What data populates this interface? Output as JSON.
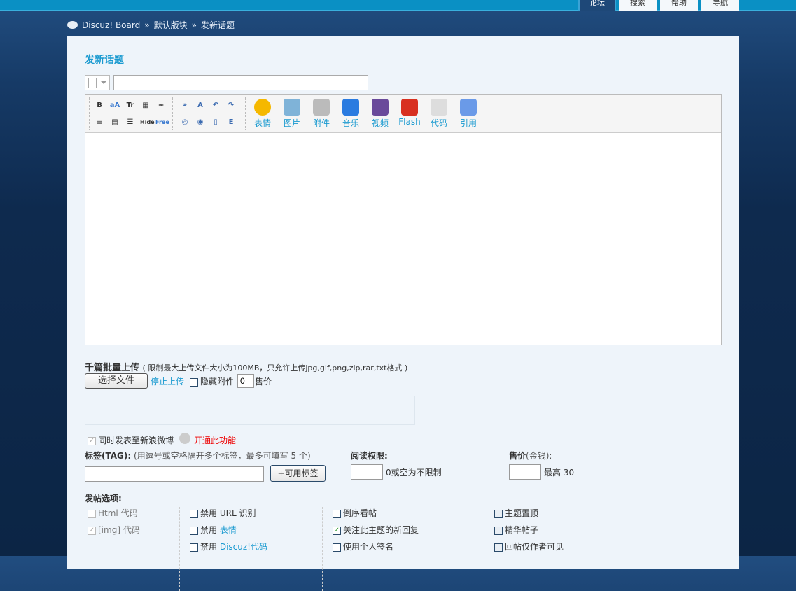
{
  "topnav": {
    "tabs": [
      {
        "label": "论坛",
        "active": true
      },
      {
        "label": "搜索"
      },
      {
        "label": "帮助"
      },
      {
        "label": "导航"
      }
    ]
  },
  "breadcrumb": {
    "items": [
      "Discuz! Board",
      "默认版块",
      "发新话题"
    ],
    "sep": "»"
  },
  "page_title": "发新话题",
  "subject": {
    "value": ""
  },
  "editor": {
    "small_icons": [
      "B",
      "aA",
      "Tr",
      "▦",
      "∞",
      "⚭",
      "A",
      "↶",
      "↷",
      "≡",
      "▤",
      "☰",
      "Hide",
      "Free",
      "◎",
      "◉",
      "▯",
      "E"
    ],
    "big_buttons": [
      {
        "label": "表情",
        "icon": "smiley-icon",
        "color": "#f5b800"
      },
      {
        "label": "图片",
        "icon": "image-icon",
        "color": "#7fb3d8"
      },
      {
        "label": "附件",
        "icon": "paperclip-icon",
        "color": "#bbbbbb"
      },
      {
        "label": "音乐",
        "icon": "music-icon",
        "color": "#2a7be0"
      },
      {
        "label": "视频",
        "icon": "video-icon",
        "color": "#6a4a9a"
      },
      {
        "label": "Flash",
        "icon": "flash-icon",
        "color": "#d83020"
      },
      {
        "label": "代码",
        "icon": "code-icon",
        "color": "#dddddd"
      },
      {
        "label": "引用",
        "icon": "quote-icon",
        "color": "#6a9ae8"
      }
    ]
  },
  "upload": {
    "title": "千篇批量上传",
    "note": "( 限制最大上传文件大小为100MB，只允许上传jpg,gif,png,zip,rar,txt格式 )",
    "choose": "选择文件",
    "stop": "停止上传",
    "hide_label": "隐藏附件",
    "price_value": "0",
    "price_label": "售价"
  },
  "weibo": {
    "label": "同时发表至新浪微博",
    "link": "开通此功能"
  },
  "tags": {
    "label": "标签(TAG):",
    "hint": "(用逗号或空格隔开多个标签，最多可填写 5 个)",
    "button": "+可用标签",
    "value": ""
  },
  "read_perm": {
    "label": "阅读权限:",
    "hint": "0或空为不限制",
    "value": ""
  },
  "price": {
    "label": "售价",
    "unit": "(金钱):",
    "hint": "最高 30",
    "value": ""
  },
  "options": {
    "title": "发帖选项:",
    "col1": [
      {
        "label": "Html 代码",
        "checked": false,
        "disabled": true
      },
      {
        "label": "[img] 代码",
        "checked": true,
        "disabled": true
      }
    ],
    "col2": [
      {
        "pre": "禁用",
        "label": "URL 识别"
      },
      {
        "pre": "禁用",
        "link": "表情"
      },
      {
        "pre": "禁用",
        "link": "Discuz!代码"
      }
    ],
    "col3": [
      {
        "label": "倒序看帖",
        "checked": false
      },
      {
        "label": "关注此主题的新回复",
        "checked": true
      },
      {
        "label": "使用个人签名",
        "checked": false
      }
    ],
    "col4": [
      {
        "label": "主题置顶"
      },
      {
        "label": "精华帖子"
      },
      {
        "label": "回帖仅作者可见"
      }
    ]
  }
}
